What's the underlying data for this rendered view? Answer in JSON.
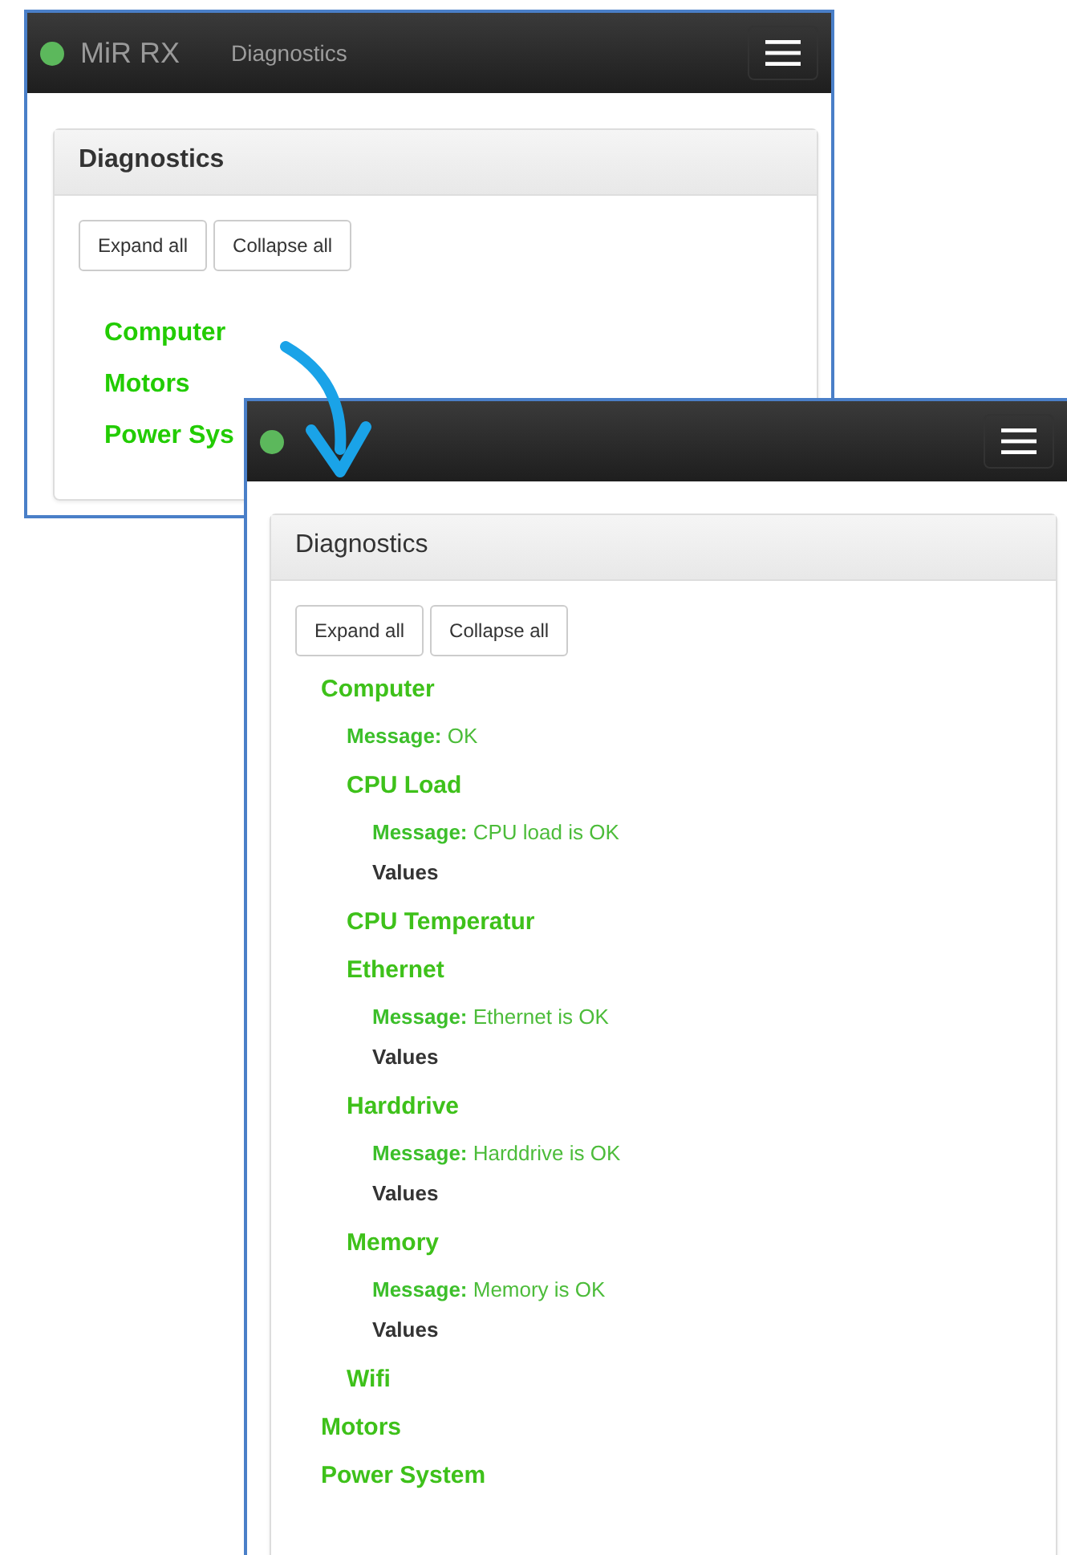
{
  "windows": [
    {
      "navbar": {
        "brand": "MiR RX",
        "link": "Diagnostics"
      },
      "panel": {
        "title": "Diagnostics",
        "buttons": [
          "Expand all",
          "Collapse all"
        ],
        "tree": [
          {
            "label": "Computer"
          },
          {
            "label": "Motors"
          },
          {
            "label": "Power Sys"
          }
        ]
      }
    },
    {
      "panel": {
        "title": "Diagnostics",
        "buttons": [
          "Expand all",
          "Collapse all"
        ],
        "tree": [
          {
            "label": "Computer",
            "message": "**Message:** OK",
            "children": [
              {
                "label": "CPU Load",
                "message": "**Message:** CPU load is OK",
                "values": "Values"
              },
              {
                "label": "CPU Temperatur"
              },
              {
                "label": "Ethernet",
                "message": "**Message:** Ethernet is OK",
                "values": "Values"
              },
              {
                "label": "Harddrive",
                "message": "**Message:** Harddrive is OK",
                "values": "Values"
              },
              {
                "label": "Memory",
                "message": "**Message:** Memory is OK",
                "values": "Values"
              },
              {
                "label": "Wifi"
              }
            ]
          },
          {
            "label": "Motors"
          },
          {
            "label": "Power System"
          }
        ]
      }
    }
  ]
}
